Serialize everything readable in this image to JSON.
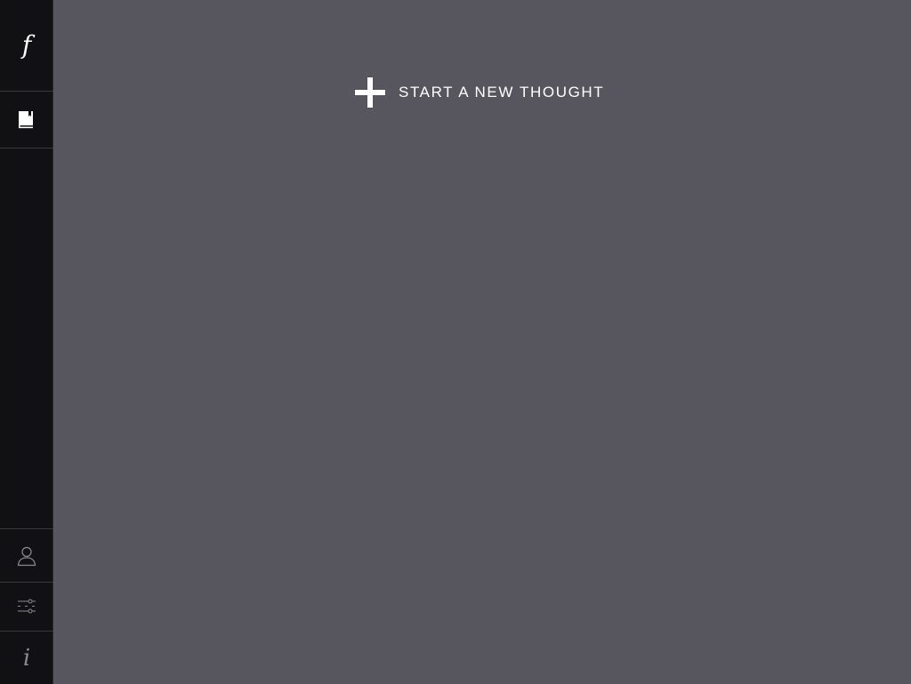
{
  "sidebar": {
    "logo": {
      "glyph": "f",
      "icon": "app-logo-icon"
    },
    "library": {
      "icon": "book-icon"
    },
    "profile": {
      "icon": "user-icon"
    },
    "settings": {
      "icon": "sliders-icon"
    },
    "info": {
      "glyph": "i",
      "icon": "info-icon"
    }
  },
  "main": {
    "new_thought_label": "START A NEW THOUGHT",
    "new_thought_icon": "plus-icon"
  },
  "colors": {
    "sidebar_bg": "#111114",
    "main_bg": "#57565f",
    "text": "#ffffff",
    "muted_icon": "#8a8a90"
  }
}
